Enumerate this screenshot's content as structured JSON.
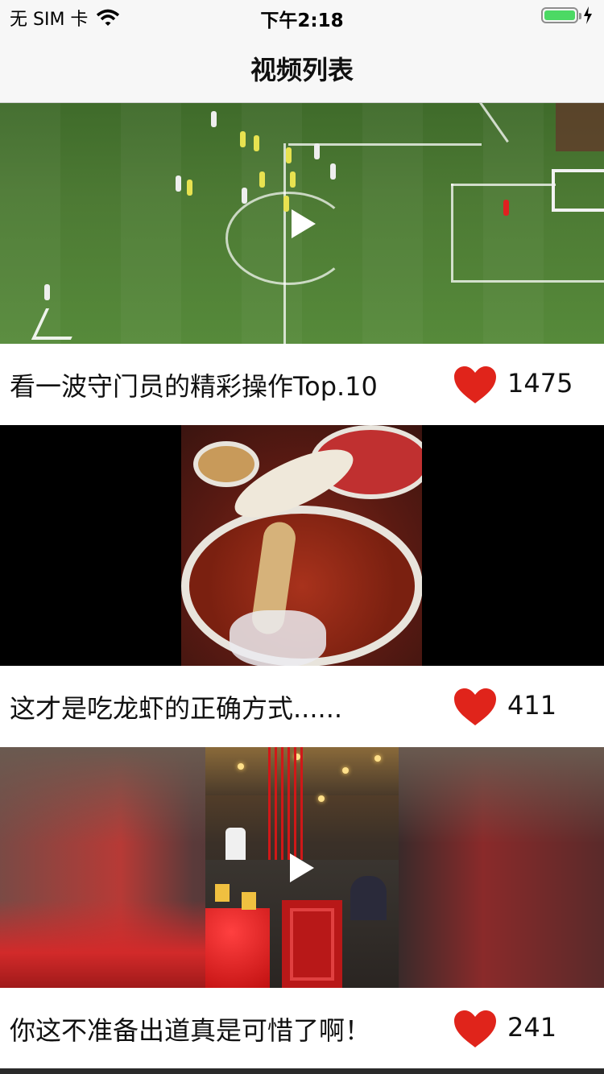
{
  "status_bar": {
    "carrier": "无 SIM 卡",
    "time": "下午2:18"
  },
  "nav": {
    "title": "视频列表"
  },
  "videos": [
    {
      "title": "看一波守门员的精彩操作Top.10",
      "likes": "1475"
    },
    {
      "title": "这才是吃龙虾的正确方式......",
      "likes": "411"
    },
    {
      "title": "你这不准备出道真是可惜了啊！",
      "likes": "241"
    }
  ],
  "colors": {
    "heart": "#e0241b",
    "battery": "#4cd964",
    "nav_background": "#f7f7f7"
  }
}
